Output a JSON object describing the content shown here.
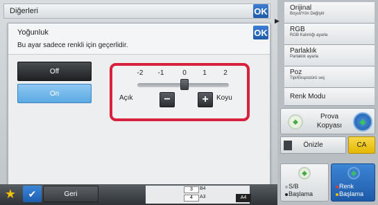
{
  "top_bar": {
    "title": "Diğerleri",
    "ok_label": "OK"
  },
  "dialog": {
    "title": "Yoğunluk",
    "subtitle": "Bu ayar sadece renkli için geçerlidir.",
    "ok_label": "OK",
    "options": [
      {
        "label": "Off",
        "selected": false
      },
      {
        "label": "On",
        "selected": true
      }
    ],
    "slider": {
      "ticks": [
        "-2",
        "-1",
        "0",
        "1",
        "2"
      ],
      "value": 0,
      "min": -2,
      "max": 2,
      "left_label": "Açık",
      "right_label": "Koyu",
      "minus_label": "−",
      "plus_label": "+"
    }
  },
  "bottom_bar": {
    "back_label": "Geri",
    "tray": {
      "row1_num": "3",
      "row1_size": "B4",
      "row2_num": "4",
      "row2_size": "A3",
      "selected_size": "A4"
    }
  },
  "right_panel": {
    "items": [
      {
        "title": "Orijinal",
        "sub": "Boyut/Yön Değiştir"
      },
      {
        "title": "RGB",
        "sub": "RGB Kalınlığı ayarla"
      },
      {
        "title": "Parlaklık",
        "sub": "Parlaklık ayarla"
      },
      {
        "title": "Poz",
        "sub": "Tipi/Ekspozürü seç"
      }
    ],
    "color_mode_label": "Renk Modu",
    "proof_copy": {
      "line1": "Prova",
      "line2": "Kopyası"
    },
    "preview_label": "Önizle",
    "ca_label": "CA",
    "bw_start": {
      "line1": "S/B",
      "line2": "Başlama"
    },
    "color_start": {
      "line1": "Renk",
      "line2": "Başlama"
    }
  },
  "colors": {
    "accent_blue": "#1f5aa8",
    "highlight_red": "#d8213c",
    "ca_yellow": "#e5b800",
    "selected_option": "#5aa9e2"
  }
}
